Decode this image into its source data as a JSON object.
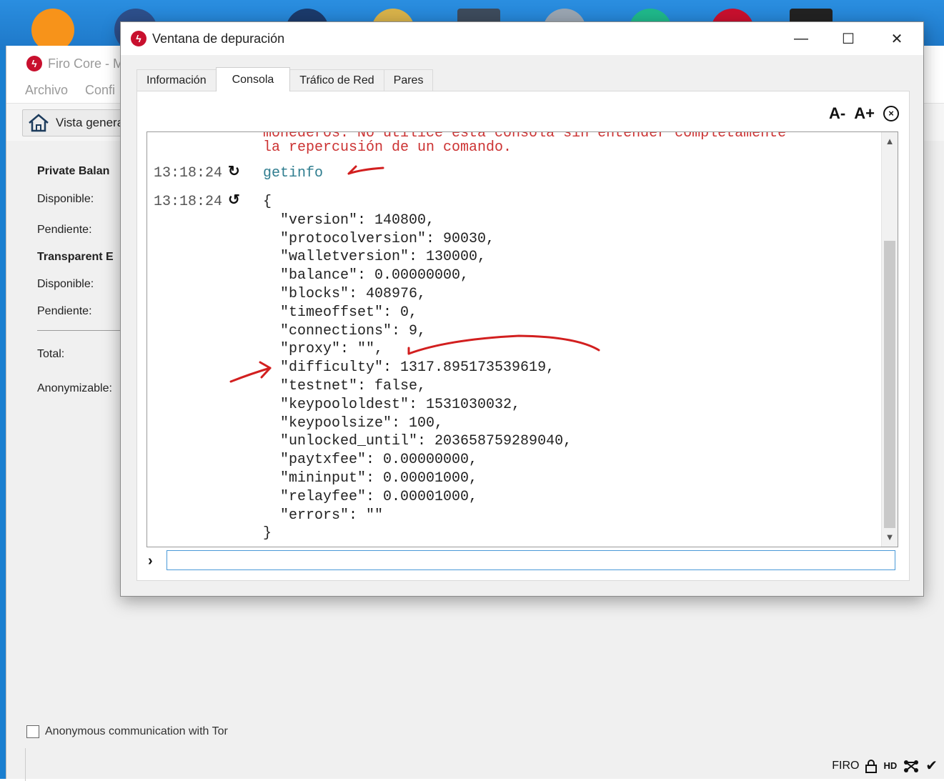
{
  "main": {
    "title": "Firo Core - M",
    "menu": [
      "Archivo",
      "Confi"
    ],
    "toolbar_overview": "Vista genera",
    "private_balance": "Private Balan",
    "disponible": "Disponible:",
    "pendiente": "Pendiente:",
    "transparent_balance": "Transparent E",
    "total": "Total:",
    "anonymizable": "Anonymizable:",
    "tor_label": "Anonymous communication with Tor",
    "status_unit": "FIRO",
    "status_hd": "HD"
  },
  "debug": {
    "title": "Ventana de depuración",
    "tabs": [
      "Información",
      "Consola",
      "Tráfico de Red",
      "Pares"
    ],
    "font_decrease": "A-",
    "font_increase": "A+",
    "console": {
      "cutoff_text": "monederos. No utilice esta consola sin entender completamente",
      "warning_text": "la repercusión de un comando.",
      "request_time": "13:18:24",
      "request_cmd": "getinfo",
      "reply_time": "13:18:24",
      "json_lines": [
        "{",
        "  \"version\": 140800,",
        "  \"protocolversion\": 90030,",
        "  \"walletversion\": 130000,",
        "  \"balance\": 0.00000000,",
        "  \"blocks\": 408976,",
        "  \"timeoffset\": 0,",
        "  \"connections\": 9,",
        "  \"proxy\": \"\",",
        "  \"difficulty\": 1317.895173539619,",
        "  \"testnet\": false,",
        "  \"keypoololdest\": 1531030032,",
        "  \"keypoolsize\": 100,",
        "  \"unlocked_until\": 203658759289040,",
        "  \"paytxfee\": 0.00000000,",
        "  \"mininput\": 0.00001000,",
        "  \"relayfee\": 0.00001000,",
        "  \"errors\": \"\"",
        "}"
      ],
      "input_value": ""
    }
  }
}
